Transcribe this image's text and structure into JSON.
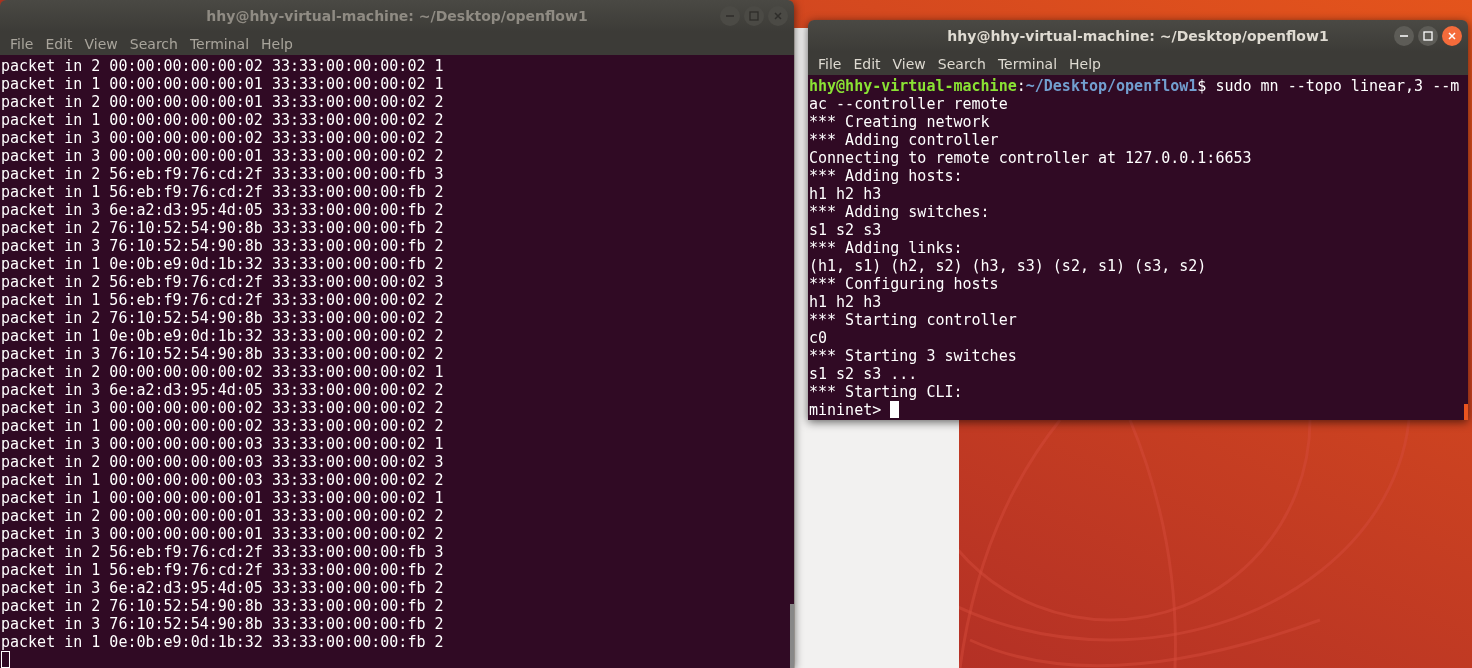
{
  "windows": [
    {
      "title": "hhy@hhy-virtual-machine: ~/Desktop/openflow1",
      "active": false,
      "menu": [
        "File",
        "Edit",
        "View",
        "Search",
        "Terminal",
        "Help"
      ],
      "cursor": true,
      "lines": [
        {
          "kind": "output",
          "text": "packet in 2 00:00:00:00:00:02 33:33:00:00:00:02 1"
        },
        {
          "kind": "output",
          "text": "packet in 1 00:00:00:00:00:01 33:33:00:00:00:02 1"
        },
        {
          "kind": "output",
          "text": "packet in 2 00:00:00:00:00:01 33:33:00:00:00:02 2"
        },
        {
          "kind": "output",
          "text": "packet in 1 00:00:00:00:00:02 33:33:00:00:00:02 2"
        },
        {
          "kind": "output",
          "text": "packet in 3 00:00:00:00:00:02 33:33:00:00:00:02 2"
        },
        {
          "kind": "output",
          "text": "packet in 3 00:00:00:00:00:01 33:33:00:00:00:02 2"
        },
        {
          "kind": "output",
          "text": "packet in 2 56:eb:f9:76:cd:2f 33:33:00:00:00:fb 3"
        },
        {
          "kind": "output",
          "text": "packet in 1 56:eb:f9:76:cd:2f 33:33:00:00:00:fb 2"
        },
        {
          "kind": "output",
          "text": "packet in 3 6e:a2:d3:95:4d:05 33:33:00:00:00:fb 2"
        },
        {
          "kind": "output",
          "text": "packet in 2 76:10:52:54:90:8b 33:33:00:00:00:fb 2"
        },
        {
          "kind": "output",
          "text": "packet in 3 76:10:52:54:90:8b 33:33:00:00:00:fb 2"
        },
        {
          "kind": "output",
          "text": "packet in 1 0e:0b:e9:0d:1b:32 33:33:00:00:00:fb 2"
        },
        {
          "kind": "output",
          "text": "packet in 2 56:eb:f9:76:cd:2f 33:33:00:00:00:02 3"
        },
        {
          "kind": "output",
          "text": "packet in 1 56:eb:f9:76:cd:2f 33:33:00:00:00:02 2"
        },
        {
          "kind": "output",
          "text": "packet in 2 76:10:52:54:90:8b 33:33:00:00:00:02 2"
        },
        {
          "kind": "output",
          "text": "packet in 1 0e:0b:e9:0d:1b:32 33:33:00:00:00:02 2"
        },
        {
          "kind": "output",
          "text": "packet in 3 76:10:52:54:90:8b 33:33:00:00:00:02 2"
        },
        {
          "kind": "output",
          "text": "packet in 2 00:00:00:00:00:02 33:33:00:00:00:02 1"
        },
        {
          "kind": "output",
          "text": "packet in 3 6e:a2:d3:95:4d:05 33:33:00:00:00:02 2"
        },
        {
          "kind": "output",
          "text": "packet in 3 00:00:00:00:00:02 33:33:00:00:00:02 2"
        },
        {
          "kind": "output",
          "text": "packet in 1 00:00:00:00:00:02 33:33:00:00:00:02 2"
        },
        {
          "kind": "output",
          "text": "packet in 3 00:00:00:00:00:03 33:33:00:00:00:02 1"
        },
        {
          "kind": "output",
          "text": "packet in 2 00:00:00:00:00:03 33:33:00:00:00:02 3"
        },
        {
          "kind": "output",
          "text": "packet in 1 00:00:00:00:00:03 33:33:00:00:00:02 2"
        },
        {
          "kind": "output",
          "text": "packet in 1 00:00:00:00:00:01 33:33:00:00:00:02 1"
        },
        {
          "kind": "output",
          "text": "packet in 2 00:00:00:00:00:01 33:33:00:00:00:02 2"
        },
        {
          "kind": "output",
          "text": "packet in 3 00:00:00:00:00:01 33:33:00:00:00:02 2"
        },
        {
          "kind": "output",
          "text": "packet in 2 56:eb:f9:76:cd:2f 33:33:00:00:00:fb 3"
        },
        {
          "kind": "output",
          "text": "packet in 1 56:eb:f9:76:cd:2f 33:33:00:00:00:fb 2"
        },
        {
          "kind": "output",
          "text": "packet in 3 6e:a2:d3:95:4d:05 33:33:00:00:00:fb 2"
        },
        {
          "kind": "output",
          "text": "packet in 2 76:10:52:54:90:8b 33:33:00:00:00:fb 2"
        },
        {
          "kind": "output",
          "text": "packet in 3 76:10:52:54:90:8b 33:33:00:00:00:fb 2"
        },
        {
          "kind": "output",
          "text": "packet in 1 0e:0b:e9:0d:1b:32 33:33:00:00:00:fb 2"
        }
      ]
    },
    {
      "title": "hhy@hhy-virtual-machine: ~/Desktop/openflow1",
      "active": true,
      "menu": [
        "File",
        "Edit",
        "View",
        "Search",
        "Terminal",
        "Help"
      ],
      "cursor": true,
      "lines": [
        {
          "kind": "prompt",
          "user": "hhy@hhy-virtual-machine",
          "separator": ":",
          "path": "~/Desktop/openflow1",
          "command": "$ sudo mn --topo linear,3 --m"
        },
        {
          "kind": "output",
          "text": "ac --controller remote"
        },
        {
          "kind": "output",
          "text": "*** Creating network"
        },
        {
          "kind": "output",
          "text": "*** Adding controller"
        },
        {
          "kind": "output",
          "text": "Connecting to remote controller at 127.0.0.1:6653"
        },
        {
          "kind": "output",
          "text": "*** Adding hosts:"
        },
        {
          "kind": "output",
          "text": "h1 h2 h3"
        },
        {
          "kind": "output",
          "text": "*** Adding switches:"
        },
        {
          "kind": "output",
          "text": "s1 s2 s3"
        },
        {
          "kind": "output",
          "text": "*** Adding links:"
        },
        {
          "kind": "output",
          "text": "(h1, s1) (h2, s2) (h3, s3) (s2, s1) (s3, s2)"
        },
        {
          "kind": "output",
          "text": "*** Configuring hosts"
        },
        {
          "kind": "output",
          "text": "h1 h2 h3"
        },
        {
          "kind": "output",
          "text": "*** Starting controller"
        },
        {
          "kind": "output",
          "text": "c0"
        },
        {
          "kind": "output",
          "text": "*** Starting 3 switches"
        },
        {
          "kind": "output",
          "text": "s1 s2 s3 ..."
        },
        {
          "kind": "output",
          "text": "*** Starting CLI:"
        },
        {
          "kind": "input",
          "text": "mininet>"
        }
      ]
    }
  ]
}
